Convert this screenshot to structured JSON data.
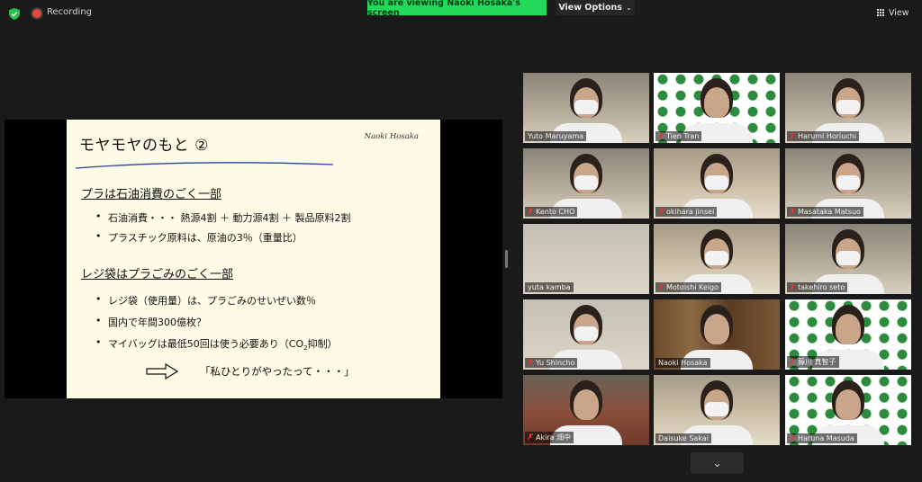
{
  "top_bar": {
    "recording_label": "Recording",
    "viewing_banner": "You are viewing Naoki Hosaka's screen",
    "view_options_label": "View Options",
    "view_label": "View",
    "icons": {
      "security": "shield-check-icon",
      "recording": "record-dot-icon",
      "view_options": "chevron-down-icon",
      "view": "grid-icon"
    },
    "colors": {
      "banner_bg": "#23d959",
      "recording_dot": "#e04a3c",
      "shield": "#27c24c"
    }
  },
  "slide": {
    "title": "モヤモヤのもと ②",
    "author": "Naoki Hosaka",
    "section1": {
      "heading": "プラは石油消費のごく一部",
      "bullets": [
        "石油消費・・・ 熱源4割 ＋ 動力源4割 ＋ 製品原料2割",
        "プラスチック原料は、原油の3％（重量比）"
      ]
    },
    "section2": {
      "heading": "レジ袋はプラごみのごく一部",
      "bullets": [
        "レジ袋（使用量）は、プラごみのせいぜい数％",
        "国内で年間300億枚？",
        "マイバッグは最低50回は使う必要あり（CO",
        "2",
        "抑制）"
      ]
    },
    "conclusion": "「私ひとりがやったって・・・」"
  },
  "participants": [
    {
      "name": "Yuto Maruyama",
      "muted": false,
      "bg": "room"
    },
    {
      "name": "Tien Tran",
      "muted": true,
      "bg": "logo"
    },
    {
      "name": "Harumi Horiuchi",
      "muted": true,
      "bg": "room"
    },
    {
      "name": "Kento CHO",
      "muted": true,
      "bg": "room"
    },
    {
      "name": "okihara jinsei",
      "muted": true,
      "bg": "room2"
    },
    {
      "name": "Masataka Matsuo",
      "muted": true,
      "bg": "room"
    },
    {
      "name": "yuta kamba",
      "muted": false,
      "bg": "wall"
    },
    {
      "name": "Motoishi Keigo",
      "muted": true,
      "bg": "room2"
    },
    {
      "name": "takehiro seto",
      "muted": true,
      "bg": "room"
    },
    {
      "name": "Yu Shincho",
      "muted": true,
      "bg": "wall"
    },
    {
      "name": "Naoki Hosaka",
      "muted": false,
      "bg": "books",
      "active_speaker": true
    },
    {
      "name": "藤川 真智子",
      "muted": true,
      "bg": "logo"
    },
    {
      "name": "Akira 畑中",
      "muted": true,
      "bg": "hall"
    },
    {
      "name": "Daisuke Sakai",
      "muted": false,
      "bg": "room2"
    },
    {
      "name": "Haruna Masuda",
      "muted": true,
      "bg": "logo"
    }
  ],
  "gallery_icons": {
    "muted": "mic-muted-icon",
    "page_down": "chevron-down-icon"
  }
}
